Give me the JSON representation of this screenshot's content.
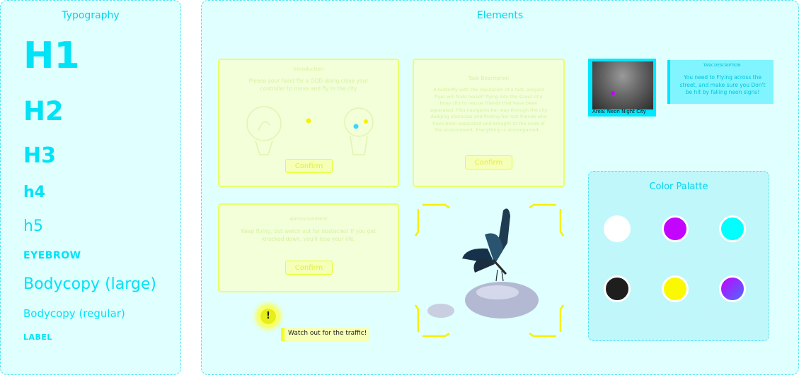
{
  "typography": {
    "title": "Typography",
    "h1": "H1",
    "h2": "H2",
    "h3": "H3",
    "h4": "h4",
    "h5": "h5",
    "eyebrow": "EYEBROW",
    "body_large": "Bodycopy (large)",
    "body_regular": "Bodycopy (regular)",
    "label": "LABEL"
  },
  "elements": {
    "title": "Elements",
    "card1": {
      "heading": "Introduction",
      "body": "Please your hand for a OOD doing close your controller to move and fly in the city",
      "button": "Confirm"
    },
    "card2": {
      "heading": "Task Description",
      "body": "A butterfly with the reputation of a fast, elegant flyer will finds herself flying into the street of a busy city to rescue friends that have been separated. Flits navigates her way through the city dodging obstacles and finding her lost friends who have been separated and brought to the ends of the environment. Everything is accompanied...",
      "button": "Confirm"
    },
    "card3": {
      "heading": "Announcement",
      "body": "Keep flying, but watch out for obstacles! If you get knocked down, you'll lose your life.",
      "button": "Confirm"
    },
    "area_label": "Area: Neon Night City",
    "task_box": {
      "heading": "TASK DESCRIPTION",
      "body": "You need to Flying across the street, and make sure you Don't be hit by falling neon signs!"
    },
    "alert_icon": "!",
    "toast": "Watch out for the traffic!",
    "palette": {
      "title": "Color Palatte",
      "swatches": [
        {
          "label": "#FFFFFF",
          "color": "#FFFFFF"
        },
        {
          "label": "#C305FF",
          "color": "#C305FF"
        },
        {
          "label": "#00FFFF",
          "color": "#00FFFF"
        },
        {
          "label": "#1E1E1E",
          "color": "#1E1E1E"
        },
        {
          "label": "#FBF901",
          "color": "#FBF901"
        },
        {
          "label": "Gradient",
          "color": "gradient"
        }
      ]
    }
  }
}
